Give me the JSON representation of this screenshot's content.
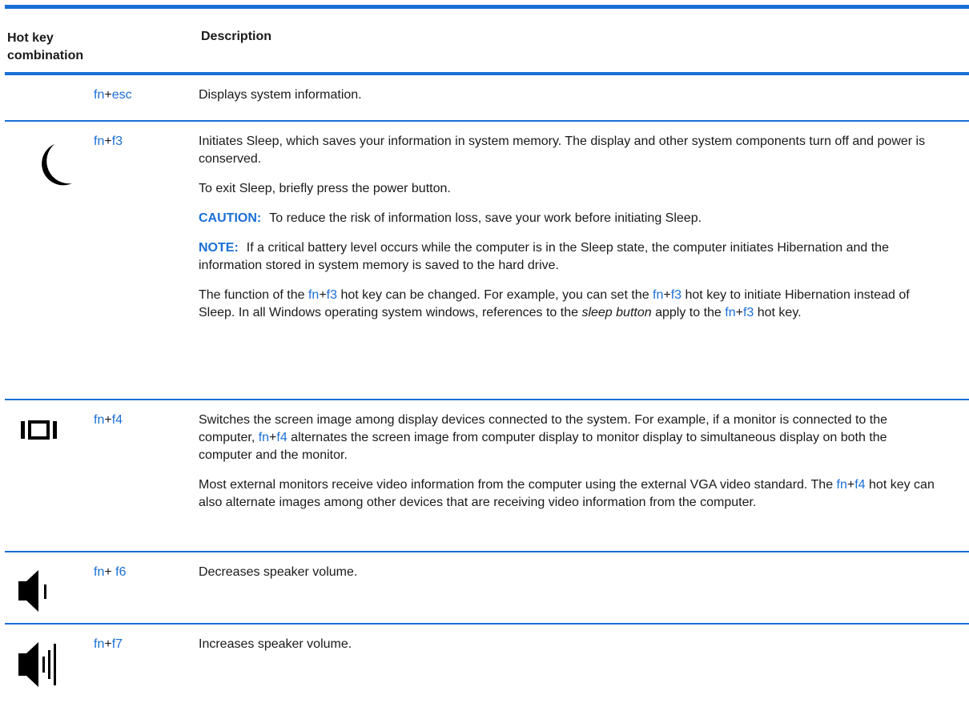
{
  "header": {
    "col1_line1": "Hot key",
    "col1_line2": "combination",
    "col2": "Description"
  },
  "rows": [
    {
      "icon": "none",
      "key1": "fn",
      "plus": "+",
      "key2": "esc",
      "desc": [
        "Displays system information."
      ]
    },
    {
      "icon": "moon-sleep-icon",
      "key1": "fn",
      "plus": "+",
      "key2": "f3",
      "desc": [
        "Initiates Sleep, which saves your information in system memory. The display and other system components turn off and power is conserved.",
        "To exit Sleep, briefly press the power button."
      ],
      "caution_label": "CAUTION:",
      "caution_text": "To reduce the risk of information loss, save your work before initiating Sleep.",
      "note_label": "NOTE:",
      "note_text": "If a critical battery level occurs while the computer is in the Sleep state, the computer initiates Hibernation and the information stored in system memory is saved to the hard drive.",
      "p5_a": "The function of the ",
      "p5_b": " hot key can be changed. For example, you can set the ",
      "p5_c": " hot key to initiate Hibernation instead of Sleep. In all Windows operating system windows, references to the ",
      "p5_italic": "sleep button",
      "p5_d": " apply to the ",
      "p5_e": " hot key."
    },
    {
      "icon": "display-switch-icon",
      "key1": "fn",
      "plus": "+",
      "key2": "f4",
      "p1_a": "Switches the screen image among display devices connected to the system. For example, if a monitor is connected to the computer, ",
      "p1_b": " alternates the screen image from computer display to monitor display to simultaneous display on both the computer and the monitor.",
      "p2_a": "Most external monitors receive video information from the computer using the external VGA video standard. The ",
      "p2_b": " hot key can also alternate images among other devices that are receiving video information from the computer."
    },
    {
      "icon": "volume-down-icon",
      "key1": "fn",
      "plus": "+ ",
      "key2": "f6",
      "desc": [
        "Decreases speaker volume."
      ]
    },
    {
      "icon": "volume-up-icon",
      "key1": "fn",
      "plus": "+",
      "key2": "f7",
      "desc": [
        "Increases speaker volume."
      ]
    }
  ]
}
